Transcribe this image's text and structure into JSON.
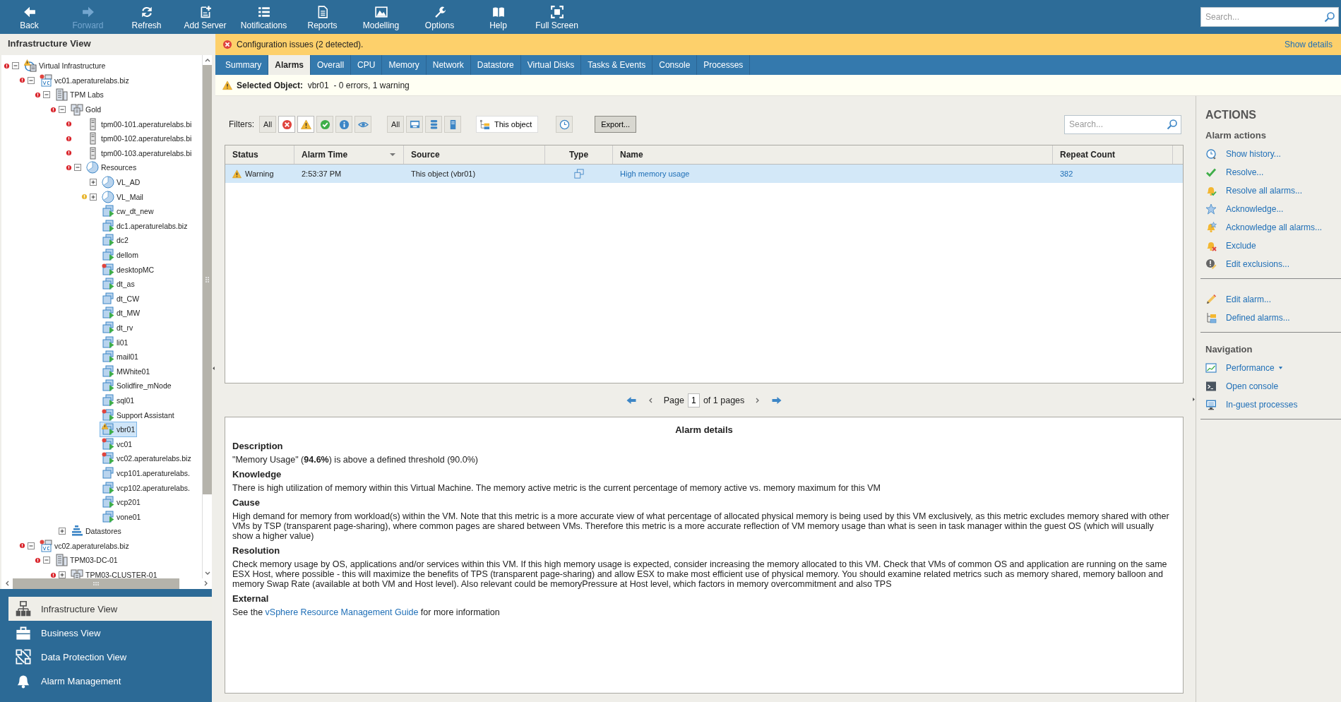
{
  "toolbar": {
    "buttons": [
      {
        "label": "Back",
        "disabled": false
      },
      {
        "label": "Forward",
        "disabled": true
      },
      {
        "label": "Refresh",
        "disabled": false
      },
      {
        "label": "Add Server",
        "disabled": false
      },
      {
        "label": "Notifications",
        "disabled": false
      },
      {
        "label": "Reports",
        "disabled": false
      },
      {
        "label": "Modelling",
        "disabled": false
      },
      {
        "label": "Options",
        "disabled": false
      },
      {
        "label": "Help",
        "disabled": false
      },
      {
        "label": "Full Screen",
        "disabled": false
      }
    ],
    "search": {
      "placeholder": "Search..."
    }
  },
  "left_panel": {
    "title": "Infrastructure View",
    "tree": [
      {
        "label": "Virtual Infrastructure",
        "kind": "vi",
        "alert": {
          "kind": "error"
        },
        "badge": {
          "kind": "warning"
        },
        "expanded": true,
        "selected": false,
        "children": [
          {
            "label": "vc01.aperaturelabs.biz",
            "kind": "vcenter",
            "alert": {
              "kind": "error"
            },
            "badge": {
              "kind": "error"
            },
            "expanded": true,
            "selected": false,
            "children": [
              {
                "label": "TPM Labs",
                "kind": "datacenter",
                "alert": {
                  "kind": "error"
                },
                "expanded": true,
                "selected": false,
                "children": [
                  {
                    "label": "Gold",
                    "kind": "cluster",
                    "alert": {
                      "kind": "error"
                    },
                    "expanded": true,
                    "selected": false,
                    "children": [
                      {
                        "label": "tpm00-101.aperaturelabs.bi",
                        "kind": "host",
                        "alert": {
                          "kind": "error"
                        },
                        "selected": false
                      },
                      {
                        "label": "tpm00-102.aperaturelabs.bi",
                        "kind": "host",
                        "alert": {
                          "kind": "error"
                        },
                        "selected": false
                      },
                      {
                        "label": "tpm00-103.aperaturelabs.bi",
                        "kind": "host",
                        "alert": {
                          "kind": "error"
                        },
                        "selected": false
                      },
                      {
                        "label": "Resources",
                        "kind": "pool",
                        "alert": {
                          "kind": "error"
                        },
                        "expanded": true,
                        "selected": false,
                        "children": [
                          {
                            "label": "VL_AD",
                            "kind": "pool",
                            "expanded": false,
                            "selected": false
                          },
                          {
                            "label": "VL_Mail",
                            "kind": "pool",
                            "alert": {
                              "kind": "warning"
                            },
                            "expanded": false,
                            "selected": false
                          },
                          {
                            "label": "cw_dt_new",
                            "kind": "vm",
                            "powered_on": true,
                            "selected": false
                          },
                          {
                            "label": "dc1.aperaturelabs.biz",
                            "kind": "vm",
                            "powered_on": true,
                            "selected": false
                          },
                          {
                            "label": "dc2",
                            "kind": "vm",
                            "powered_on": true,
                            "selected": false
                          },
                          {
                            "label": "dellom",
                            "kind": "vm",
                            "powered_on": true,
                            "selected": false
                          },
                          {
                            "label": "desktopMC",
                            "kind": "vm",
                            "powered_on": true,
                            "badge": {
                              "kind": "error"
                            },
                            "selected": false
                          },
                          {
                            "label": "dt_as",
                            "kind": "vm",
                            "powered_on": true,
                            "selected": false
                          },
                          {
                            "label": "dt_CW",
                            "kind": "vm",
                            "powered_on": false,
                            "selected": false
                          },
                          {
                            "label": "dt_MW",
                            "kind": "vm",
                            "powered_on": true,
                            "selected": false
                          },
                          {
                            "label": "dt_rv",
                            "kind": "vm",
                            "powered_on": true,
                            "selected": false
                          },
                          {
                            "label": "li01",
                            "kind": "vm",
                            "powered_on": true,
                            "selected": false
                          },
                          {
                            "label": "mail01",
                            "kind": "vm",
                            "powered_on": true,
                            "selected": false
                          },
                          {
                            "label": "MWhite01",
                            "kind": "vm",
                            "powered_on": true,
                            "selected": false
                          },
                          {
                            "label": "Solidfire_mNode",
                            "kind": "vm",
                            "powered_on": true,
                            "selected": false
                          },
                          {
                            "label": "sql01",
                            "kind": "vm",
                            "powered_on": true,
                            "selected": false
                          },
                          {
                            "label": "Support Assistant",
                            "kind": "vm",
                            "powered_on": true,
                            "badge": {
                              "kind": "error"
                            },
                            "selected": false
                          },
                          {
                            "label": "vbr01",
                            "kind": "vm",
                            "powered_on": true,
                            "badge": {
                              "kind": "warning"
                            },
                            "selected": true
                          },
                          {
                            "label": "vc01",
                            "kind": "vm",
                            "powered_on": true,
                            "badge": {
                              "kind": "error"
                            },
                            "selected": false
                          },
                          {
                            "label": "vc02.aperaturelabs.biz",
                            "kind": "vm",
                            "powered_on": true,
                            "badge": {
                              "kind": "error"
                            },
                            "selected": false
                          },
                          {
                            "label": "vcp101.aperaturelabs.",
                            "kind": "vm",
                            "powered_on": false,
                            "selected": false
                          },
                          {
                            "label": "vcp102.aperaturelabs.",
                            "kind": "vm",
                            "powered_on": true,
                            "selected": false
                          },
                          {
                            "label": "vcp201",
                            "kind": "vm",
                            "powered_on": true,
                            "selected": false
                          },
                          {
                            "label": "vone01",
                            "kind": "vm",
                            "powered_on": true,
                            "selected": false
                          }
                        ]
                      }
                    ]
                  },
                  {
                    "label": "Datastores",
                    "kind": "datastores",
                    "expanded": false,
                    "selected": false
                  }
                ]
              }
            ]
          },
          {
            "label": "vc02.aperaturelabs.biz",
            "kind": "vcenter",
            "alert": {
              "kind": "error"
            },
            "badge": {
              "kind": "error"
            },
            "expanded": true,
            "selected": false,
            "children": [
              {
                "label": "TPM03-DC-01",
                "kind": "datacenter",
                "alert": {
                  "kind": "error"
                },
                "expanded": true,
                "selected": false,
                "children": [
                  {
                    "label": "TPM03-CLUSTER-01",
                    "kind": "cluster",
                    "alert": {
                      "kind": "error"
                    },
                    "expanded": false,
                    "selected": false
                  }
                ]
              }
            ]
          }
        ]
      }
    ],
    "views": [
      {
        "label": "Infrastructure View",
        "selected": true
      },
      {
        "label": "Business View",
        "selected": false
      },
      {
        "label": "Data Protection View",
        "selected": false
      },
      {
        "label": "Alarm Management",
        "selected": false
      }
    ]
  },
  "config_bar": {
    "message": "Configuration issues (2 detected).",
    "link": "Show details"
  },
  "tabs": [
    {
      "label": "Summary",
      "selected": false
    },
    {
      "label": "Alarms",
      "selected": true
    },
    {
      "label": "Overall",
      "selected": false
    },
    {
      "label": "CPU",
      "selected": false
    },
    {
      "label": "Memory",
      "selected": false
    },
    {
      "label": "Network",
      "selected": false
    },
    {
      "label": "Datastore",
      "selected": false
    },
    {
      "label": "Virtual Disks",
      "selected": false
    },
    {
      "label": "Tasks & Events",
      "selected": false
    },
    {
      "label": "Console",
      "selected": false
    },
    {
      "label": "Processes",
      "selected": false
    }
  ],
  "selected_object": "**Selected Object:**  vbr01  - 0 errors, 1 warning",
  "filters": {
    "label": "Filters:",
    "status_buttons": [
      {
        "kind": "all",
        "label": "All",
        "selected": false
      },
      {
        "kind": "error",
        "selected": true
      },
      {
        "kind": "warning",
        "selected": true
      },
      {
        "kind": "ok",
        "selected": false
      },
      {
        "kind": "info",
        "selected": false
      },
      {
        "kind": "watch",
        "selected": false
      }
    ],
    "type_buttons": [
      {
        "kind": "all",
        "label": "All",
        "selected": false
      },
      {
        "kind": "vm",
        "selected": false
      },
      {
        "kind": "datastore",
        "selected": false
      },
      {
        "kind": "host",
        "selected": false
      }
    ],
    "scope": "This object",
    "export": "Export...",
    "search": {
      "placeholder": "Search..."
    }
  },
  "table": {
    "columns": [
      {
        "label": "Status",
        "sorted": false
      },
      {
        "label": "Alarm Time",
        "sorted": true
      },
      {
        "label": "Source",
        "sorted": false
      },
      {
        "label": "Type",
        "sorted": false
      },
      {
        "label": "Name",
        "sorted": false
      },
      {
        "label": "Repeat Count",
        "sorted": false
      }
    ],
    "rows": [
      {
        "kind": "warning",
        "status": "Warning",
        "time": "2:53:37 PM",
        "source": "This object (vbr01)",
        "name": "High memory usage",
        "repeat_count": "382",
        "selected": true
      }
    ]
  },
  "pagination": {
    "page_label": "Page",
    "page": "1",
    "of_label": "of 1 pages"
  },
  "details": {
    "title": "Alarm details",
    "sections": [
      {
        "heading": "Description",
        "text": "\"Memory Usage\" (**94.6%**) is above a defined threshold (90.0%)"
      },
      {
        "heading": "Knowledge",
        "text": "There is high utilization of memory within this Virtual Machine. The memory active metric is the current percentage of memory active vs. memory maximum for this VM"
      },
      {
        "heading": "Cause",
        "text": "High demand for memory from workload(s) within the VM. Note that this metric is a more accurate view of what percentage of allocated physical memory is being used by this VM exclusively, as this metric excludes memory shared with other VMs by TSP (transparent page-sharing), where common pages are shared between VMs. Therefore this metric is a more accurate reflection of VM memory usage than what is seen in task manager within the guest OS (which will usually show a higher value)"
      },
      {
        "heading": "Resolution",
        "text": "Check memory usage by OS, applications and/or services within this VM. If this high memory usage is expected, consider increasing the memory allocated to this VM. Check that VMs of common OS and application are running on the same ESX Host, where possible - this will maximize the benefits of TPS (transparent page-sharing) and allow ESX to make most efficient use of physical memory. You should examine related metrics such as memory shared, memory balloon and memory Swap Rate (available at both VM and Host level). Also relevant could be memoryPressure at Host level, which factors in memory overcommitment and also TPS"
      },
      {
        "heading": "External",
        "parts": [
          {
            "kind": "text",
            "text": "See the "
          },
          {
            "kind": "link",
            "text": "vSphere Resource Management Guide"
          },
          {
            "kind": "text",
            "text": " for more information"
          }
        ]
      }
    ]
  },
  "actions": {
    "title": "ACTIONS",
    "groups": [
      {
        "heading": "Alarm actions",
        "items": [
          {
            "label": "Show history..."
          },
          {
            "label": "Resolve..."
          },
          {
            "label": "Resolve all alarms..."
          },
          {
            "label": "Acknowledge..."
          },
          {
            "label": "Acknowledge all alarms..."
          },
          {
            "label": "Exclude"
          },
          {
            "label": "Edit exclusions..."
          }
        ]
      },
      {
        "items": [
          {
            "label": "Edit alarm..."
          },
          {
            "label": "Defined alarms..."
          }
        ]
      },
      {
        "heading": "Navigation",
        "items": [
          {
            "label": "Performance",
            "dropdown": true
          },
          {
            "label": "Open console"
          },
          {
            "label": "In-guest processes"
          }
        ]
      }
    ]
  }
}
